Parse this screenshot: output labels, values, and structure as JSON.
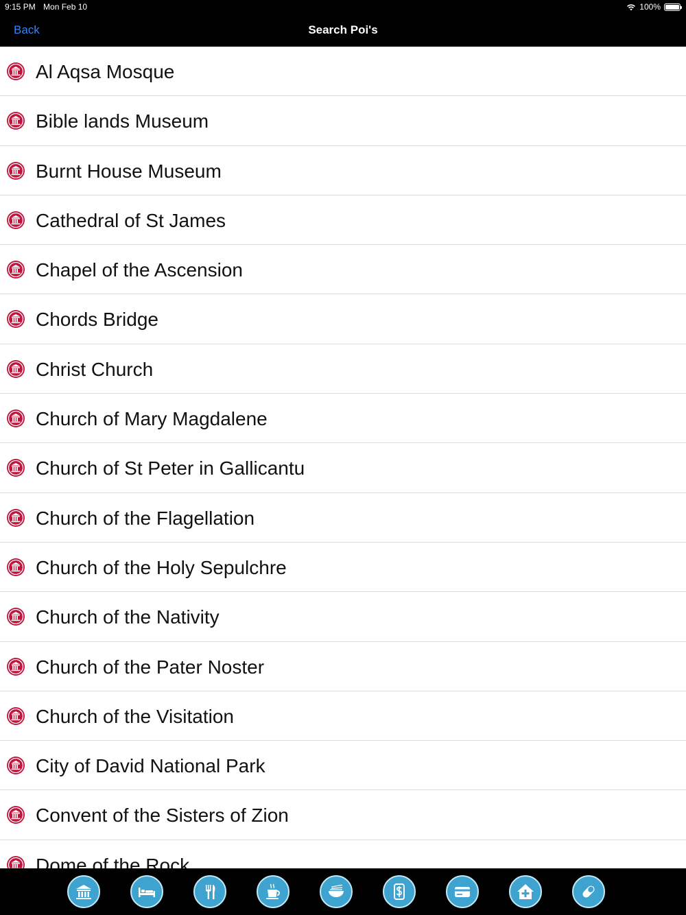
{
  "status_bar": {
    "time": "9:15 PM",
    "date": "Mon Feb 10",
    "battery": "100%",
    "battery_level": 1.0
  },
  "nav": {
    "back_label": "Back",
    "title": "Search Poi's"
  },
  "list": {
    "item_icon": "museum-icon",
    "item_icon_color": "#c0143c",
    "items": [
      "Al Aqsa Mosque",
      "Bible lands Museum",
      "Burnt House Museum",
      "Cathedral of St James",
      "Chapel of the Ascension",
      "Chords Bridge",
      "Christ Church",
      "Church of Mary Magdalene",
      "Church of St Peter in Gallicantu",
      "Church of the Flagellation",
      "Church of the Holy Sepulchre",
      "Church of the Nativity",
      "Church of the Pater Noster",
      "Church of the Visitation",
      "City of David National Park",
      "Convent of the Sisters of Zion",
      "Dome of the Rock"
    ]
  },
  "tab_bar": {
    "accent": "#3ea3cf",
    "items": [
      {
        "icon": "museum-icon"
      },
      {
        "icon": "bed-icon"
      },
      {
        "icon": "fork-knife-icon"
      },
      {
        "icon": "coffee-cup-icon"
      },
      {
        "icon": "noodle-bowl-icon"
      },
      {
        "icon": "dollar-icon"
      },
      {
        "icon": "credit-card-icon"
      },
      {
        "icon": "hospital-icon"
      },
      {
        "icon": "pill-icon"
      }
    ]
  }
}
